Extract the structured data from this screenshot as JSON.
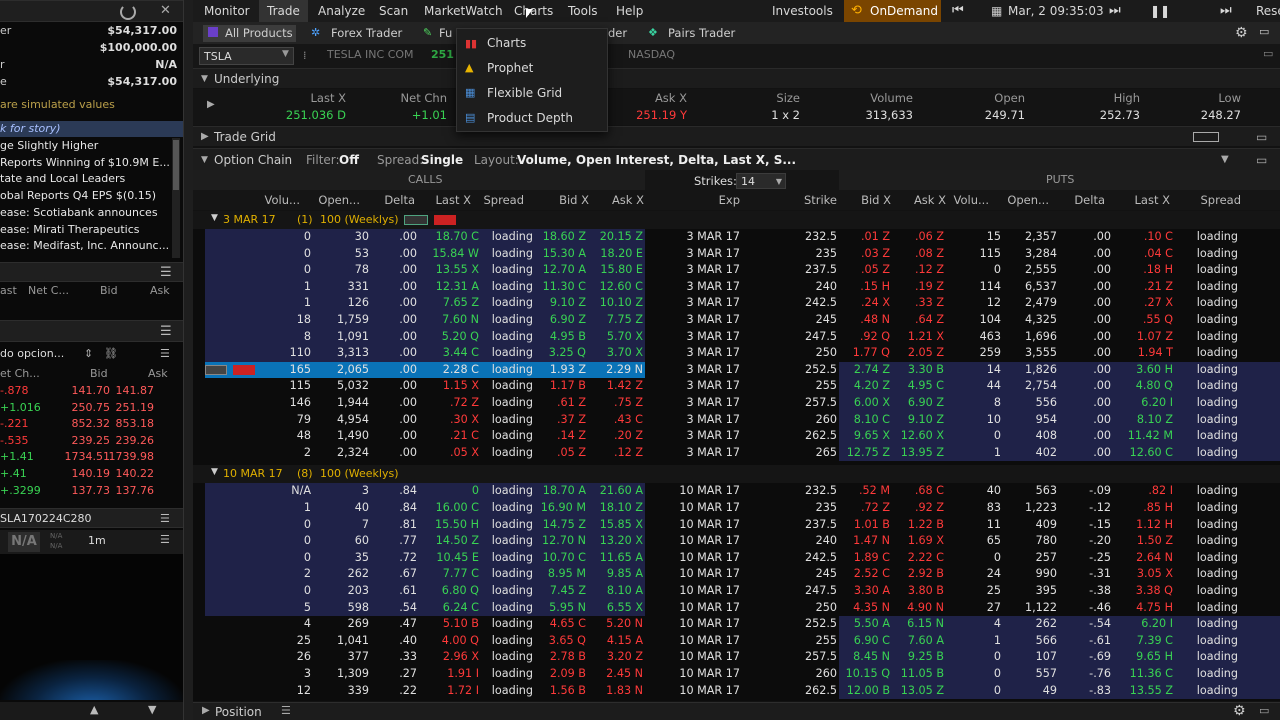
{
  "left": {
    "refresh_icon": "refresh-icon",
    "balances": [
      {
        "label": "er",
        "value": "$54,317.00"
      },
      {
        "label": "",
        "value": "$100,000.00"
      },
      {
        "label": "r",
        "value": "N/A"
      },
      {
        "label": "e",
        "value": "$54,317.00"
      }
    ],
    "simulated_note": "are simulated values",
    "news_header": "k for story)",
    "news": [
      "ge Slightly Higher",
      "Reports Winning of $10.9M E...",
      "tate and Local Leaders Comm...",
      "obal Reports Q4 EPS $(0.15) v...",
      "ease: Scotiabank announces ...",
      "ease: Mirati Therapeutics Rep...",
      "ease: Medifast, Inc. Announc..."
    ],
    "watch_headers": [
      "ast",
      "Net C...",
      "Bid",
      "Ask"
    ],
    "opcion_label": "do opcion...",
    "quote_headers": [
      "et Ch...",
      "Bid",
      "Ask"
    ],
    "quotes": [
      {
        "chg": "-.878",
        "bid": "141.70",
        "ask": "141.87"
      },
      {
        "chg": "+1.016",
        "bid": "250.75",
        "ask": "251.19"
      },
      {
        "chg": "-.221",
        "bid": "852.32",
        "ask": "853.18"
      },
      {
        "chg": "-.535",
        "bid": "239.25",
        "ask": "239.26"
      },
      {
        "chg": "+1.41",
        "bid": "1734.51",
        "ask": "1739.98"
      },
      {
        "chg": "+.41",
        "bid": "140.19",
        "ask": "140.22"
      },
      {
        "chg": "+.3299",
        "bid": "137.73",
        "ask": "137.76"
      }
    ],
    "chart_symbol": "SLA170224C280",
    "chart_na": "N/A",
    "chart_na_small1": "N/A",
    "chart_na_small2": "N/A",
    "chart_period": "1m"
  },
  "menu": {
    "items": [
      "Monitor",
      "Trade",
      "Analyze",
      "Scan",
      "MarketWatch",
      "Charts",
      "Tools",
      "Help"
    ],
    "right": [
      "Investools",
      "OnDemand",
      "Mar, 2 09:35:03",
      "Rese"
    ]
  },
  "tabs": {
    "items": [
      "All Products",
      "Forex Trader",
      "Fu",
      "der",
      "Pairs Trader"
    ]
  },
  "symbol_bar": {
    "symbol": "TSLA",
    "company": "TESLA INC COM",
    "price_prefix": "251",
    "exchange": "NASDAQ"
  },
  "underlying": {
    "title": "Underlying",
    "headers": [
      "Last X",
      "Net Chn",
      "Ask X",
      "Size",
      "Volume",
      "Open",
      "High",
      "Low"
    ],
    "values": [
      "251.036 D",
      "+1.01",
      "251.19 Y",
      "1 x 2",
      "313,633",
      "249.71",
      "252.73",
      "248.27"
    ]
  },
  "trade_grid": "Trade Grid",
  "option_chain": {
    "title": "Option Chain",
    "filter_label": "Filter:",
    "filter": "Off",
    "spread_label": "Spread:",
    "spread": "Single",
    "layout_label": "Layout:",
    "layout": "Volume, Open Interest, Delta, Last X, S...",
    "calls": "CALLS",
    "puts": "PUTS",
    "strikes_label": "Strikes:",
    "strikes": "14",
    "call_headers": [
      "Volu...",
      "Open...",
      "Delta",
      "Last X",
      "Spread",
      "Bid X",
      "Ask X"
    ],
    "mid_headers": [
      "Exp",
      "Strike"
    ],
    "put_headers": [
      "Bid X",
      "Ask X",
      "Volu...",
      "Open...",
      "Delta",
      "Last X",
      "Spread"
    ],
    "groups": [
      {
        "label": "3 MAR 17",
        "count": "(1)",
        "kind": "100 (Weeklys)",
        "exp": "3 MAR 17",
        "rows": [
          [
            "0",
            "30",
            ".00",
            "18.70 C",
            "loading",
            "18.60 Z",
            "20.15 Z",
            "232.5",
            ".01 Z",
            ".06 Z",
            "15",
            "2,357",
            ".00",
            ".10 C",
            "loading"
          ],
          [
            "0",
            "53",
            ".00",
            "15.84 W",
            "loading",
            "15.30 A",
            "18.20 E",
            "235",
            ".03 Z",
            ".08 Z",
            "115",
            "3,284",
            ".00",
            ".04 C",
            "loading"
          ],
          [
            "0",
            "78",
            ".00",
            "13.55 X",
            "loading",
            "12.70 A",
            "15.80 E",
            "237.5",
            ".05 Z",
            ".12 Z",
            "0",
            "2,555",
            ".00",
            ".18 H",
            "loading"
          ],
          [
            "1",
            "331",
            ".00",
            "12.31 A",
            "loading",
            "11.30 C",
            "12.60 C",
            "240",
            ".15 H",
            ".19 Z",
            "114",
            "6,537",
            ".00",
            ".21 Z",
            "loading"
          ],
          [
            "1",
            "126",
            ".00",
            "7.65 Z",
            "loading",
            "9.10 Z",
            "10.10 Z",
            "242.5",
            ".24 X",
            ".33 Z",
            "12",
            "2,479",
            ".00",
            ".27 X",
            "loading"
          ],
          [
            "18",
            "1,759",
            ".00",
            "7.60 N",
            "loading",
            "6.90 Z",
            "7.75 Z",
            "245",
            ".48 N",
            ".64 Z",
            "104",
            "4,325",
            ".00",
            ".55 Q",
            "loading"
          ],
          [
            "8",
            "1,091",
            ".00",
            "5.20 Q",
            "loading",
            "4.95 B",
            "5.70 X",
            "247.5",
            ".92 Q",
            "1.21 X",
            "463",
            "1,696",
            ".00",
            "1.07 Z",
            "loading"
          ],
          [
            "110",
            "3,313",
            ".00",
            "3.44 C",
            "loading",
            "3.25 Q",
            "3.70 X",
            "250",
            "1.77 Q",
            "2.05 Z",
            "259",
            "3,555",
            ".00",
            "1.94 T",
            "loading"
          ],
          [
            "165",
            "2,065",
            ".00",
            "2.28 C",
            "loading",
            "1.93 Z",
            "2.29 N",
            "252.5",
            "2.74 Z",
            "3.30 B",
            "14",
            "1,826",
            ".00",
            "3.60 H",
            "loading"
          ],
          [
            "115",
            "5,032",
            ".00",
            "1.15 X",
            "loading",
            "1.17 B",
            "1.42 Z",
            "255",
            "4.20 Z",
            "4.95 C",
            "44",
            "2,754",
            ".00",
            "4.80 Q",
            "loading"
          ],
          [
            "146",
            "1,944",
            ".00",
            ".72 Z",
            "loading",
            ".61 Z",
            ".75 Z",
            "257.5",
            "6.00 X",
            "6.90 Z",
            "8",
            "556",
            ".00",
            "6.20 I",
            "loading"
          ],
          [
            "79",
            "4,954",
            ".00",
            ".30 X",
            "loading",
            ".37 Z",
            ".43 C",
            "260",
            "8.10 C",
            "9.10 Z",
            "10",
            "954",
            ".00",
            "8.10 Z",
            "loading"
          ],
          [
            "48",
            "1,490",
            ".00",
            ".21 C",
            "loading",
            ".14 Z",
            ".20 Z",
            "262.5",
            "9.65 X",
            "12.60 X",
            "0",
            "408",
            ".00",
            "11.42 M",
            "loading"
          ],
          [
            "2",
            "2,324",
            ".00",
            ".05 X",
            "loading",
            ".05 Z",
            ".12 Z",
            "265",
            "12.75 Z",
            "13.95 Z",
            "1",
            "402",
            ".00",
            "12.60 C",
            "loading"
          ]
        ]
      },
      {
        "label": "10 MAR 17",
        "count": "(8)",
        "kind": "100 (Weeklys)",
        "exp": "10 MAR 17",
        "rows": [
          [
            "N/A",
            "3",
            ".84",
            "0",
            "loading",
            "18.70 A",
            "21.60 A",
            "232.5",
            ".52 M",
            ".68 C",
            "40",
            "563",
            "-.09",
            ".82 I",
            "loading"
          ],
          [
            "1",
            "40",
            ".84",
            "16.00 C",
            "loading",
            "16.90 M",
            "18.10 Z",
            "235",
            ".72 Z",
            ".92 Z",
            "83",
            "1,223",
            "-.12",
            ".85 H",
            "loading"
          ],
          [
            "0",
            "7",
            ".81",
            "15.50 H",
            "loading",
            "14.75 Z",
            "15.85 X",
            "237.5",
            "1.01 B",
            "1.22 B",
            "11",
            "409",
            "-.15",
            "1.12 H",
            "loading"
          ],
          [
            "0",
            "60",
            ".77",
            "14.50 Z",
            "loading",
            "12.70 N",
            "13.20 X",
            "240",
            "1.47 N",
            "1.69 X",
            "65",
            "780",
            "-.20",
            "1.50 Z",
            "loading"
          ],
          [
            "0",
            "35",
            ".72",
            "10.45 E",
            "loading",
            "10.70 C",
            "11.65 A",
            "242.5",
            "1.89 C",
            "2.22 C",
            "0",
            "257",
            "-.25",
            "2.64 N",
            "loading"
          ],
          [
            "2",
            "262",
            ".67",
            "7.77 C",
            "loading",
            "8.95 M",
            "9.85 A",
            "245",
            "2.52 C",
            "2.92 B",
            "24",
            "990",
            "-.31",
            "3.05 X",
            "loading"
          ],
          [
            "0",
            "203",
            ".61",
            "6.80 Q",
            "loading",
            "7.45 Z",
            "8.10 A",
            "247.5",
            "3.30 A",
            "3.80 B",
            "25",
            "395",
            "-.38",
            "3.38 Q",
            "loading"
          ],
          [
            "5",
            "598",
            ".54",
            "6.24 C",
            "loading",
            "5.95 N",
            "6.55 X",
            "250",
            "4.35 N",
            "4.90 N",
            "27",
            "1,122",
            "-.46",
            "4.75 H",
            "loading"
          ],
          [
            "4",
            "269",
            ".47",
            "5.10 B",
            "loading",
            "4.65 C",
            "5.20 N",
            "252.5",
            "5.50 A",
            "6.15 N",
            "4",
            "262",
            "-.54",
            "6.20 I",
            "loading"
          ],
          [
            "25",
            "1,041",
            ".40",
            "4.00 Q",
            "loading",
            "3.65 Q",
            "4.15 A",
            "255",
            "6.90 C",
            "7.60 A",
            "1",
            "566",
            "-.61",
            "7.39 C",
            "loading"
          ],
          [
            "26",
            "377",
            ".33",
            "2.96 X",
            "loading",
            "2.78 B",
            "3.20 Z",
            "257.5",
            "8.45 N",
            "9.25 B",
            "0",
            "107",
            "-.69",
            "9.65 H",
            "loading"
          ],
          [
            "3",
            "1,309",
            ".27",
            "1.91 I",
            "loading",
            "2.09 B",
            "2.45 N",
            "260",
            "10.15 Q",
            "11.05 B",
            "0",
            "557",
            "-.76",
            "11.36 C",
            "loading"
          ],
          [
            "12",
            "339",
            ".22",
            "1.72 I",
            "loading",
            "1.56 B",
            "1.83 N",
            "262.5",
            "12.00 B",
            "13.05 Z",
            "0",
            "49",
            "-.83",
            "13.55 Z",
            "loading"
          ]
        ]
      }
    ]
  },
  "dropdown": {
    "items": [
      "Charts",
      "Prophet",
      "Flexible Grid",
      "Product Depth"
    ]
  },
  "footer": {
    "position": "Position"
  }
}
